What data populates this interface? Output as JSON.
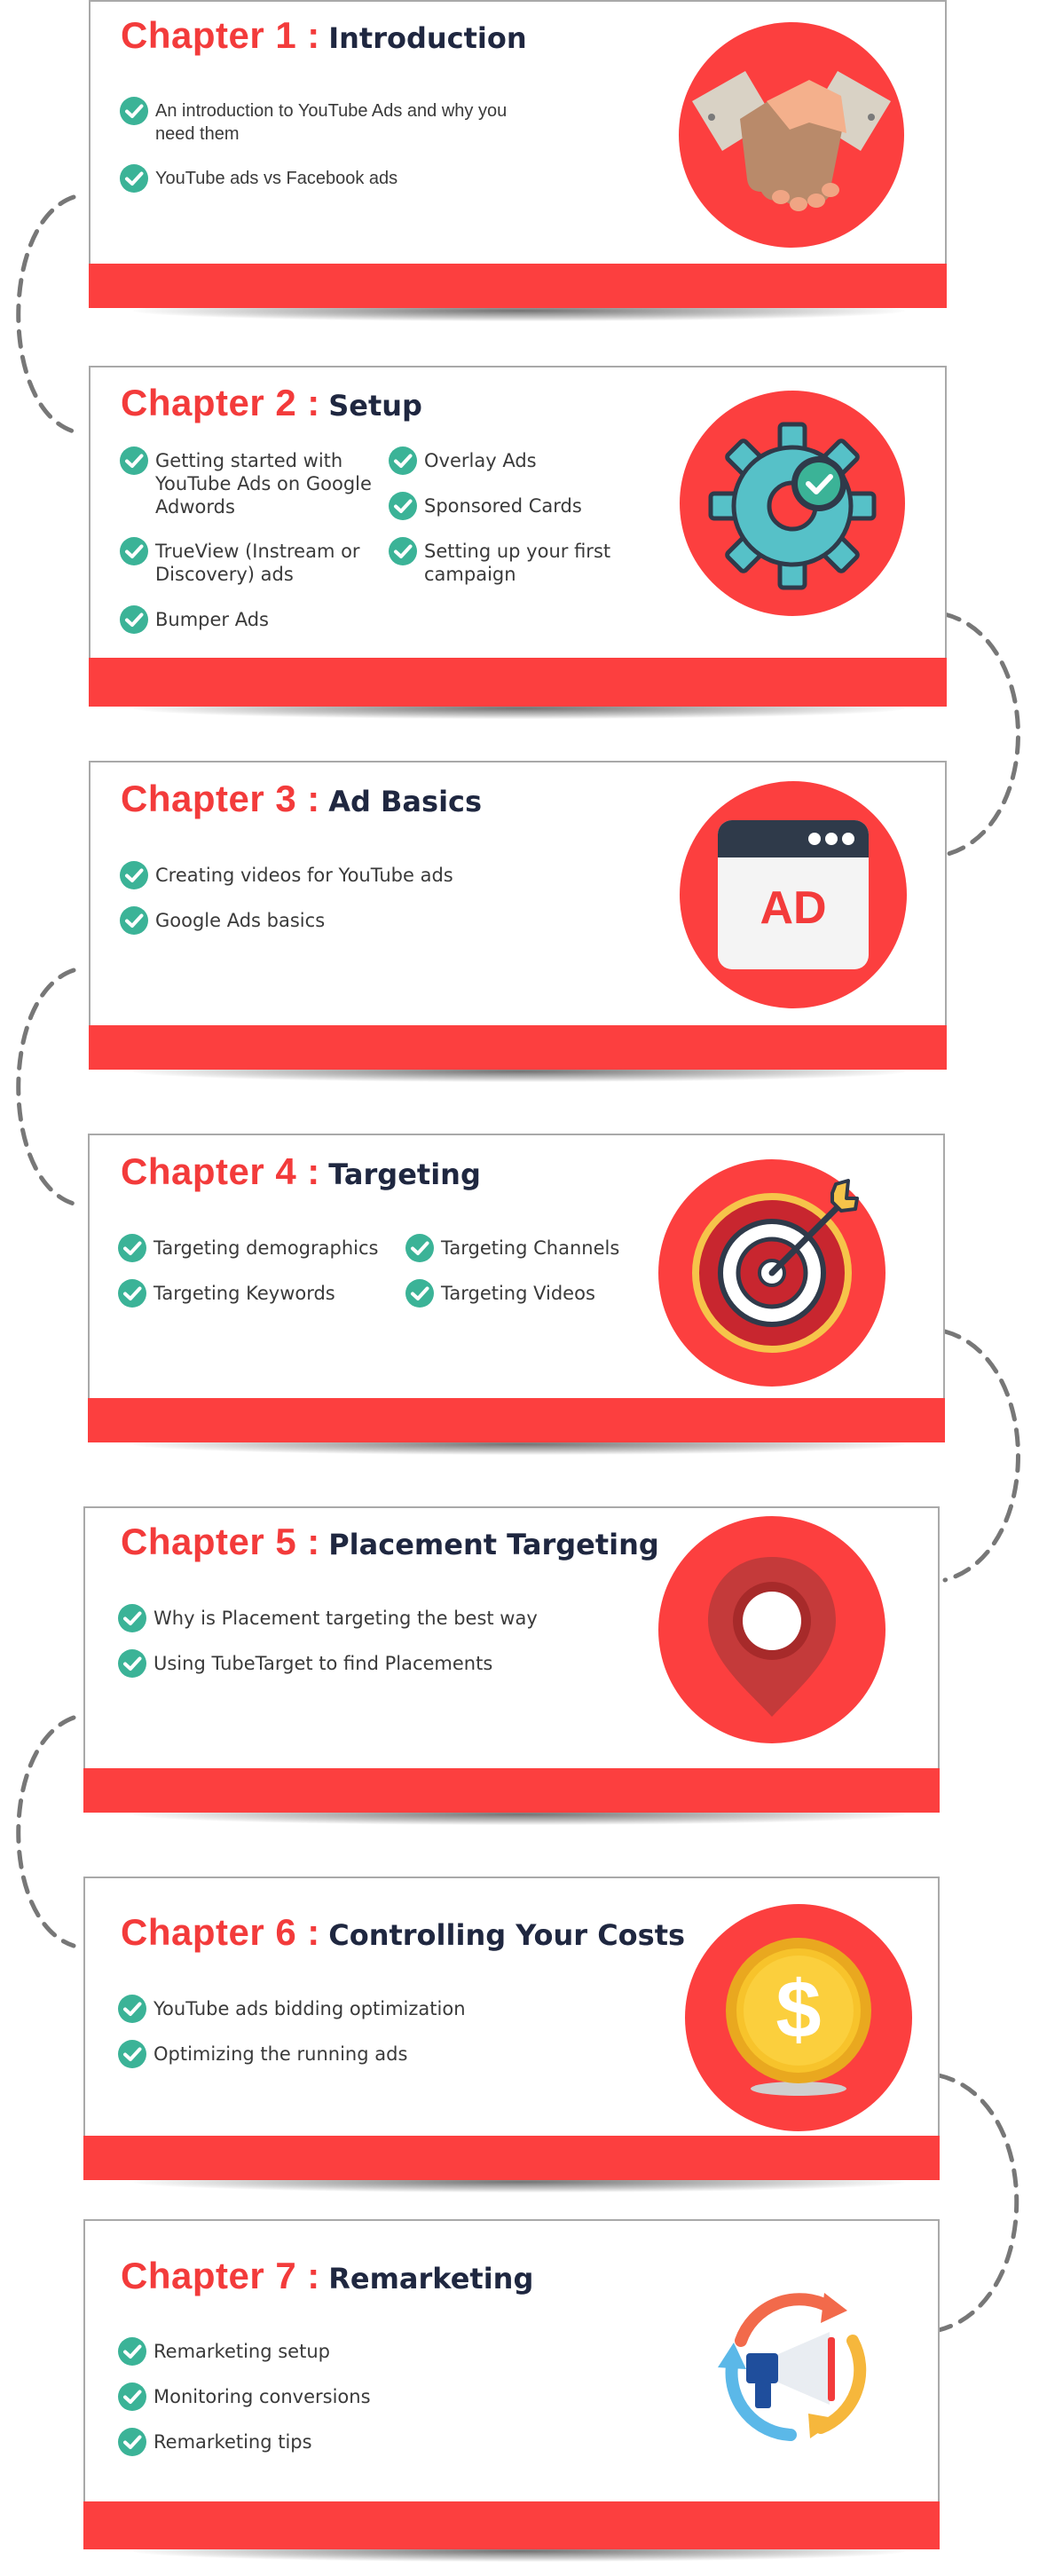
{
  "chapters": [
    {
      "number": "Chapter 1",
      "name": "Introduction",
      "items": [
        "An introduction to YouTube Ads and why you need them",
        "YouTube ads vs Facebook ads"
      ]
    },
    {
      "number": "Chapter 2",
      "name": "Setup",
      "items": [
        "Getting started with YouTube Ads on Google Adwords",
        "TrueView (Instream or Discovery) ads",
        "Bumper Ads",
        "Overlay Ads",
        "Sponsored Cards",
        "Setting up your first campaign"
      ]
    },
    {
      "number": "Chapter 3",
      "name": "Ad Basics",
      "items": [
        "Creating videos for YouTube ads",
        "Google Ads basics"
      ]
    },
    {
      "number": "Chapter 4",
      "name": "Targeting",
      "items": [
        "Targeting demographics",
        "Targeting Keywords",
        "Targeting Channels",
        "Targeting Videos"
      ]
    },
    {
      "number": "Chapter 5",
      "name": "Placement Targeting",
      "items": [
        "Why is Placement targeting the best way",
        "Using TubeTarget to find Placements"
      ]
    },
    {
      "number": "Chapter 6",
      "name": "Controlling Your Costs",
      "items": [
        "YouTube ads bidding optimization",
        "Optimizing the running ads"
      ]
    },
    {
      "number": "Chapter 7",
      "name": "Remarketing",
      "items": [
        "Remarketing setup",
        "Monitoring conversions",
        "Remarketing tips"
      ]
    }
  ],
  "ad_icon_text": "AD",
  "colors": {
    "accent_red": "#fc3f3f",
    "title_red": "#f33b3b",
    "title_dark": "#1f2740",
    "check_teal": "#3bb397"
  }
}
